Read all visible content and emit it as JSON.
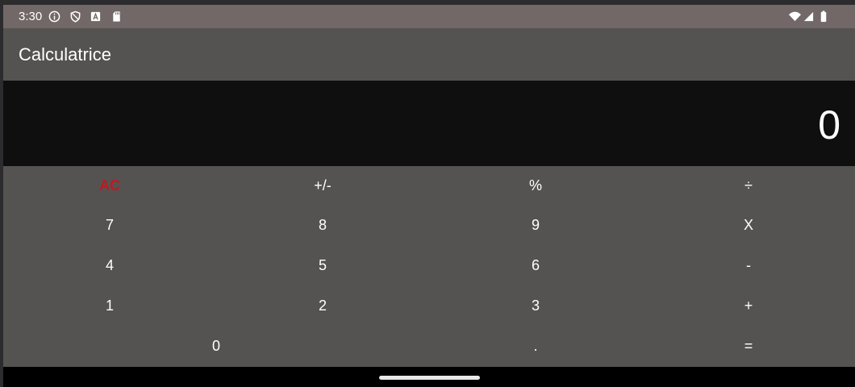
{
  "status_bar": {
    "time": "3:30",
    "left_icons": [
      "info-icon",
      "shield-icon",
      "keyboard-a-icon",
      "sd-card-icon"
    ],
    "right_icons": [
      "wifi-icon",
      "signal-icon",
      "battery-icon"
    ]
  },
  "app_bar": {
    "title": "Calculatrice"
  },
  "display": {
    "value": "0"
  },
  "keypad": {
    "row1": [
      "AC",
      "+/-",
      "%",
      "÷"
    ],
    "row2": [
      "7",
      "8",
      "9",
      "X"
    ],
    "row3": [
      "4",
      "5",
      "6",
      "-"
    ],
    "row4": [
      "1",
      "2",
      "3",
      "+"
    ],
    "row5": [
      "0",
      ".",
      "="
    ]
  },
  "colors": {
    "status_bar": "#716867",
    "app_bar": "#545352",
    "display_bg": "#100f10",
    "keypad_bg": "#545352",
    "ac_text": "#c0191f"
  }
}
